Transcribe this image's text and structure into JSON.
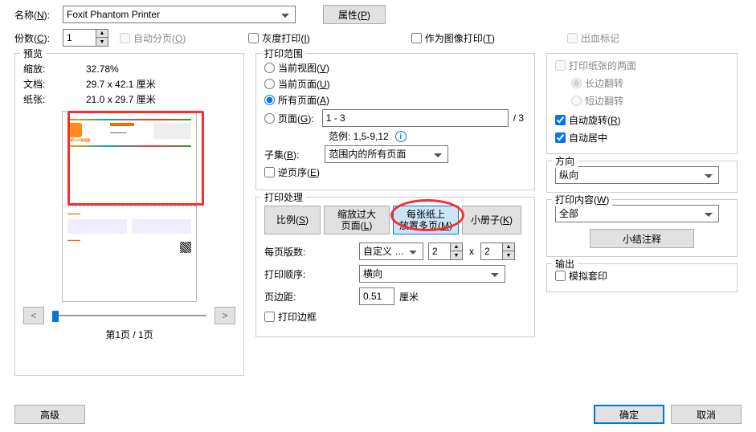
{
  "top": {
    "name_label": "名称(",
    "name_key": "N",
    "printer_name": "Foxit Phantom Printer",
    "props_btn": "属性(",
    "props_key": "P",
    "copies_label": "份数(",
    "copies_key": "C",
    "copies_val": "1",
    "collate_label": "自动分页(",
    "collate_key": "O",
    "gray_label": "灰度打印(",
    "gray_key": "I",
    "asimage_label": "作为图像打印(",
    "asimage_key": "T",
    "bleed_label": "出血标记"
  },
  "preview": {
    "title": "预览",
    "zoom_label": "缩放:",
    "zoom_val": "32.78%",
    "doc_label": "文档:",
    "doc_val": "29.7 x 42.1 厘米",
    "paper_label": "纸张:",
    "paper_val": "21.0 x 29.7 厘米",
    "page_indicator": "第1页 / 1页"
  },
  "range": {
    "title": "打印范围",
    "current_view": "当前视图(",
    "current_view_k": "V",
    "current_page": "当前页面(",
    "current_page_k": "U",
    "all_pages": "所有页面(",
    "all_pages_k": "A",
    "pages": "页面(",
    "pages_k": "G",
    "pages_input": "1 - 3",
    "total_suffix": "/ 3",
    "example_label": "范例: 1,5-9,12",
    "subset_label": "子集(",
    "subset_k": "B",
    "subset_val": "范围内的所有页面",
    "reverse_label": "逆页序(",
    "reverse_k": "E"
  },
  "handling": {
    "title": "打印处理",
    "tabs": {
      "scale": "比例(",
      "scale_k": "S",
      "fit": "缩放过大\n页面(",
      "fit_k": "L",
      "multi": "每张纸上\n放置多页(",
      "multi_k": "M",
      "booklet": "小册子(",
      "booklet_k": "K"
    },
    "per_sheet_label": "每页版数:",
    "per_sheet_mode": "自定义 …",
    "per_sheet_a": "2",
    "per_sheet_x": "x",
    "per_sheet_b": "2",
    "order_label": "打印顺序:",
    "order_val": "横向",
    "margin_label": "页边距:",
    "margin_val": "0.51",
    "margin_unit": "厘米",
    "border_label": "打印边框"
  },
  "duplex": {
    "both_label": "打印纸张的两面",
    "long_edge": "长边翻转",
    "short_edge": "短边翻转",
    "autorotate": "自动旋转(",
    "autorotate_k": "R",
    "autocenter": "自动居中"
  },
  "orient": {
    "title": "方向",
    "val": "纵向"
  },
  "content": {
    "title": "打印内容(",
    "title_k": "W",
    "val": "全部",
    "notes_btn": "小结注释"
  },
  "output": {
    "title": "输出",
    "simulate": "模拟套印"
  },
  "footer": {
    "adv": "高级",
    "ok": "确定",
    "cancel": "取消"
  }
}
